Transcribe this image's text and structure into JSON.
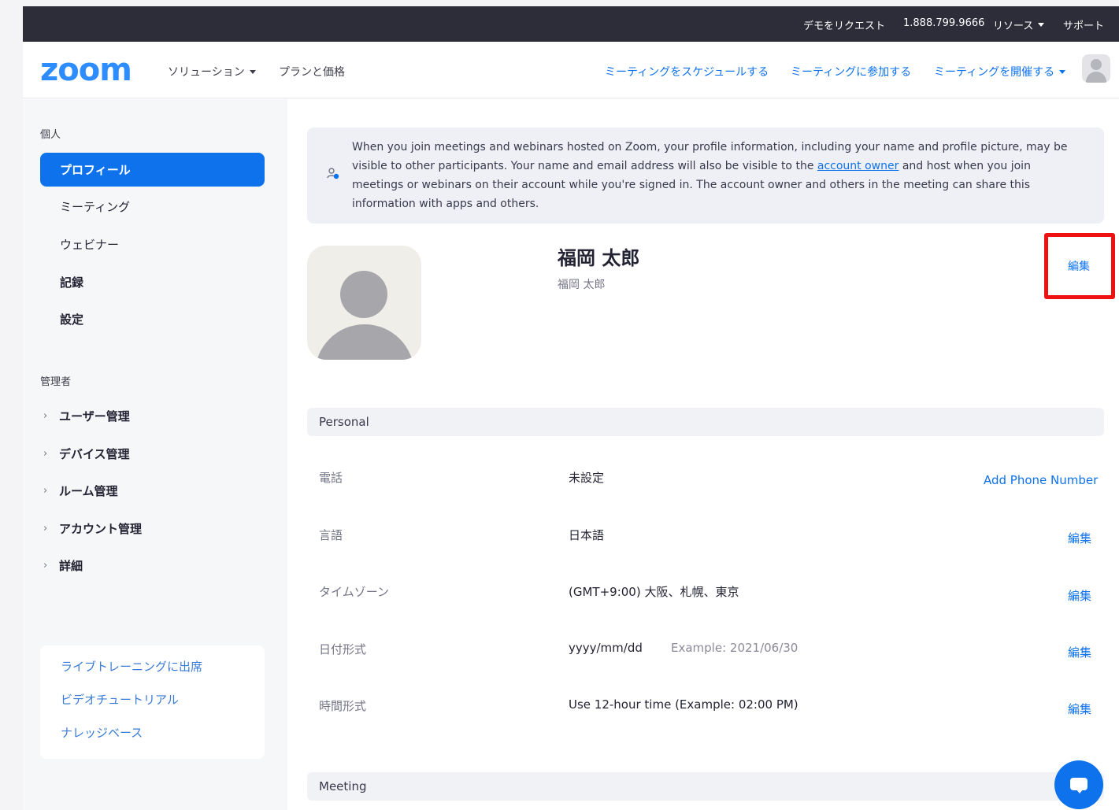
{
  "topbar": {
    "request_demo": "デモをリクエスト",
    "phone": "1.888.799.9666",
    "resources": "リソース",
    "support": "サポート"
  },
  "header": {
    "logo": "zoom",
    "solutions": "ソリューション",
    "plans": "プランと価格",
    "schedule": "ミーティングをスケジュールする",
    "join": "ミーティングに参加する",
    "host": "ミーティングを開催する"
  },
  "sidebar": {
    "personal_label": "個人",
    "items": [
      {
        "label": "プロフィール"
      },
      {
        "label": "ミーティング"
      },
      {
        "label": "ウェビナー"
      },
      {
        "label": "記録"
      },
      {
        "label": "設定"
      }
    ],
    "admin_label": "管理者",
    "admin_items": [
      {
        "label": "ユーザー管理"
      },
      {
        "label": "デバイス管理"
      },
      {
        "label": "ルーム管理"
      },
      {
        "label": "アカウント管理"
      },
      {
        "label": "詳細"
      }
    ],
    "help_links": [
      {
        "label": "ライブトレーニングに出席"
      },
      {
        "label": "ビデオチュートリアル"
      },
      {
        "label": "ナレッジベース"
      }
    ]
  },
  "notice": {
    "text_before": "When you join meetings and webinars hosted on Zoom, your profile information, including your name and profile picture, may be visible to other participants. Your name and email address will also be visible to the ",
    "link": "account owner",
    "text_after": " and host when you join meetings or webinars on their account while you're signed in. The account owner and others in the meeting can share this information with apps and others."
  },
  "profile": {
    "display_name": "福岡 太郎",
    "sub_name": "福岡 太郎",
    "edit": "編集"
  },
  "personal": {
    "section": "Personal",
    "rows": [
      {
        "label": "電話",
        "value": "未設定",
        "action": "Add Phone Number"
      },
      {
        "label": "言語",
        "value": "日本語",
        "action": "編集"
      },
      {
        "label": "タイムゾーン",
        "value": "(GMT+9:00) 大阪、札幌、東京",
        "action": "編集"
      },
      {
        "label": "日付形式",
        "value": "yyyy/mm/dd",
        "example": "Example: 2021/06/30",
        "action": "編集"
      },
      {
        "label": "時間形式",
        "value": "Use 12-hour time (Example: 02:00 PM)",
        "action": "編集"
      }
    ]
  },
  "meeting": {
    "section": "Meeting"
  },
  "colors": {
    "accent": "#0e72ed",
    "topbar": "#2d2d3a",
    "highlight": "#ee1111"
  }
}
